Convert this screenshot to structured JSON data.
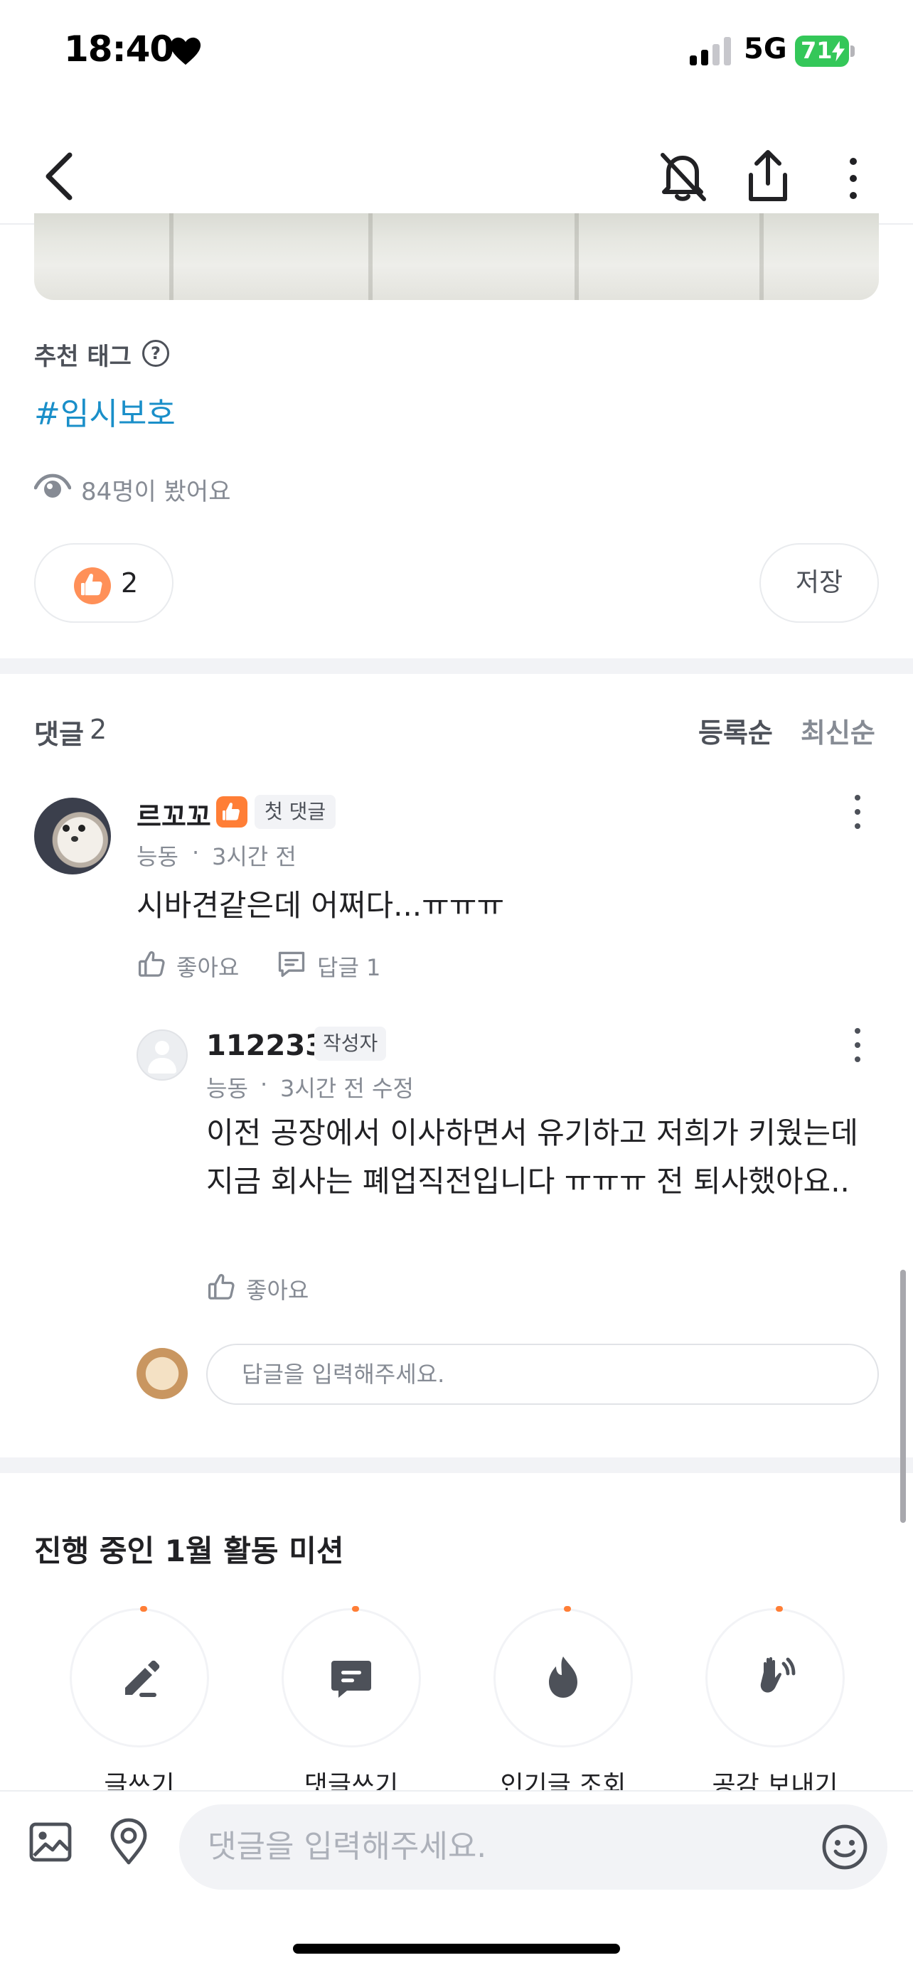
{
  "status_bar": {
    "time": "18:40",
    "network": "5G",
    "battery": "71",
    "icons": [
      "heart-icon",
      "signal-icon",
      "battery-icon"
    ]
  },
  "nav": {
    "icons": [
      "back-icon",
      "notification-off-icon",
      "share-icon",
      "more-icon"
    ]
  },
  "post": {
    "tag_title": "추천 태그",
    "help": "?",
    "hashtag": "#임시보호",
    "views": "84명이 봤어요",
    "like_count": "2",
    "save_label": "저장"
  },
  "comments": {
    "title": "댓글",
    "count": "2",
    "sort_registered": "등록순",
    "sort_newest": "최신순",
    "items": [
      {
        "name": "르꼬꼬",
        "badge": "첫 댓글",
        "location": "능동",
        "time": "3시간 전",
        "body": "시바견같은데 어쩌다...ㅠㅠㅠ",
        "like_label": "좋아요",
        "reply_label": "답글 1"
      },
      {
        "name": "112233",
        "badge": "작성자",
        "location": "능동",
        "time": "3시간 전 수정",
        "body": "이전 공장에서 이사하면서 유기하고 저희가 키웠는데 지금 회사는 폐업직전입니다 ㅠㅠㅠ 전 퇴사했아요..",
        "like_label": "좋아요"
      }
    ],
    "reply_placeholder": "답글을 입력해주세요."
  },
  "missions": {
    "title": "진행 중인 1월 활동 미션",
    "items": [
      {
        "label": "글쓰기",
        "icon": "pencil-icon"
      },
      {
        "label": "댓글쓰기",
        "icon": "chat-icon"
      },
      {
        "label": "인기글 조회",
        "icon": "fire-icon"
      },
      {
        "label": "공감 보내기",
        "icon": "wave-hand-icon"
      }
    ]
  },
  "bottom": {
    "comment_placeholder": "댓글을 입력해주세요.",
    "icons": [
      "image-icon",
      "location-icon",
      "emoji-icon"
    ]
  },
  "colors": {
    "accent": "#ff7e36",
    "link": "#1a8fc9",
    "muted": "#868b94",
    "divider": "#f2f3f6"
  }
}
